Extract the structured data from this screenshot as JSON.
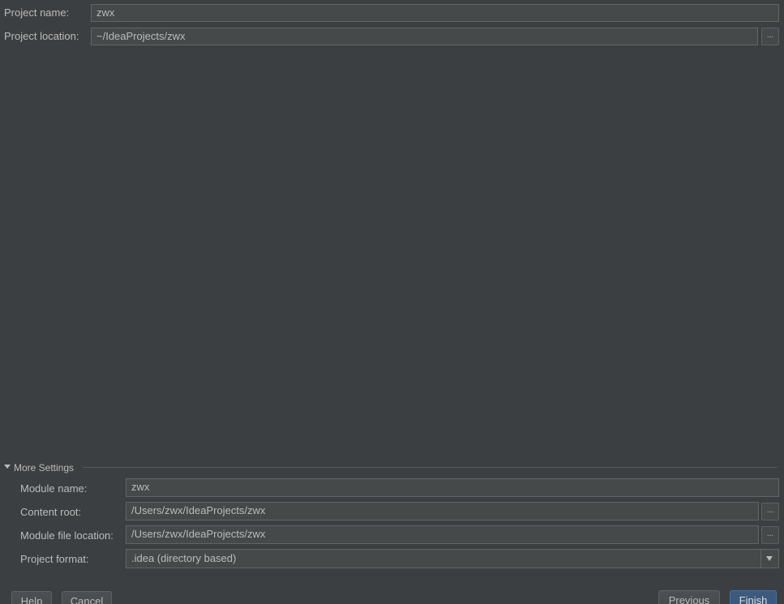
{
  "project": {
    "name_label": "Project name:",
    "name_value": "zwx",
    "location_label": "Project location:",
    "location_value": "~/IdeaProjects/zwx",
    "browse_label": "..."
  },
  "more_settings": {
    "title": "More Settings",
    "module_name_label": "Module name:",
    "module_name_value": "zwx",
    "content_root_label": "Content root:",
    "content_root_value": "/Users/zwx/IdeaProjects/zwx",
    "module_file_label": "Module file location:",
    "module_file_value": "/Users/zwx/IdeaProjects/zwx",
    "project_format_label": "Project format:",
    "project_format_value": ".idea (directory based)",
    "browse_label": "..."
  },
  "buttons": {
    "help": "Help",
    "cancel": "Cancel",
    "previous": "Previous",
    "finish": "Finish"
  }
}
